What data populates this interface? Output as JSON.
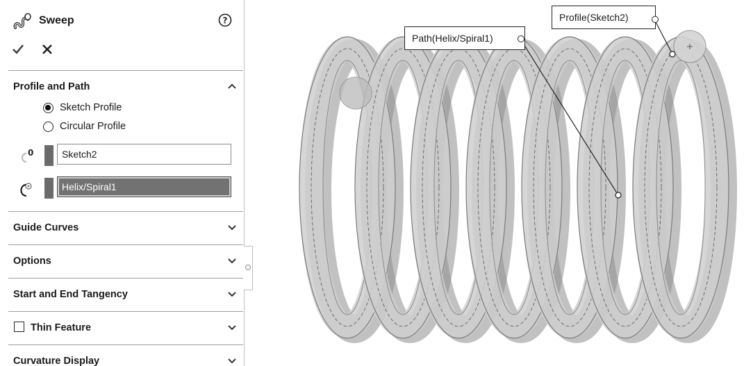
{
  "property_manager": {
    "title": "Sweep",
    "help_icon": "question-circle-icon",
    "feature_icon": "sweep-feature-icon",
    "ok_icon": "checkmark-icon",
    "cancel_icon": "close-icon",
    "sections": {
      "profile_and_path": {
        "label": "Profile and Path",
        "expanded": true,
        "options": [
          {
            "label": "Sketch Profile",
            "selected": true
          },
          {
            "label": "Circular Profile",
            "selected": false
          }
        ],
        "profile_field": {
          "value": "Sketch2",
          "icon": "sweep-profile-icon"
        },
        "path_field": {
          "value": "Helix/Spiral1",
          "icon": "sweep-path-icon",
          "active": true
        }
      },
      "guide_curves": {
        "label": "Guide Curves",
        "expanded": false
      },
      "options": {
        "label": "Options",
        "expanded": false
      },
      "start_end_tangency": {
        "label": "Start and End Tangency",
        "expanded": false
      },
      "thin_feature": {
        "label": "Thin Feature",
        "checked": false,
        "expanded": false
      },
      "curvature_display": {
        "label": "Curvature Display",
        "expanded": false
      }
    }
  },
  "viewport": {
    "callouts": {
      "path": "Path(Helix/Spiral1)",
      "profile": "Profile(Sketch2)"
    },
    "model": "helical-spring-sweep"
  },
  "colors": {
    "active_field_bg": "#727272",
    "swatch": "#6b6b6b",
    "spring_light": "#d8d8d8",
    "spring_dark": "#6e6e6e"
  }
}
